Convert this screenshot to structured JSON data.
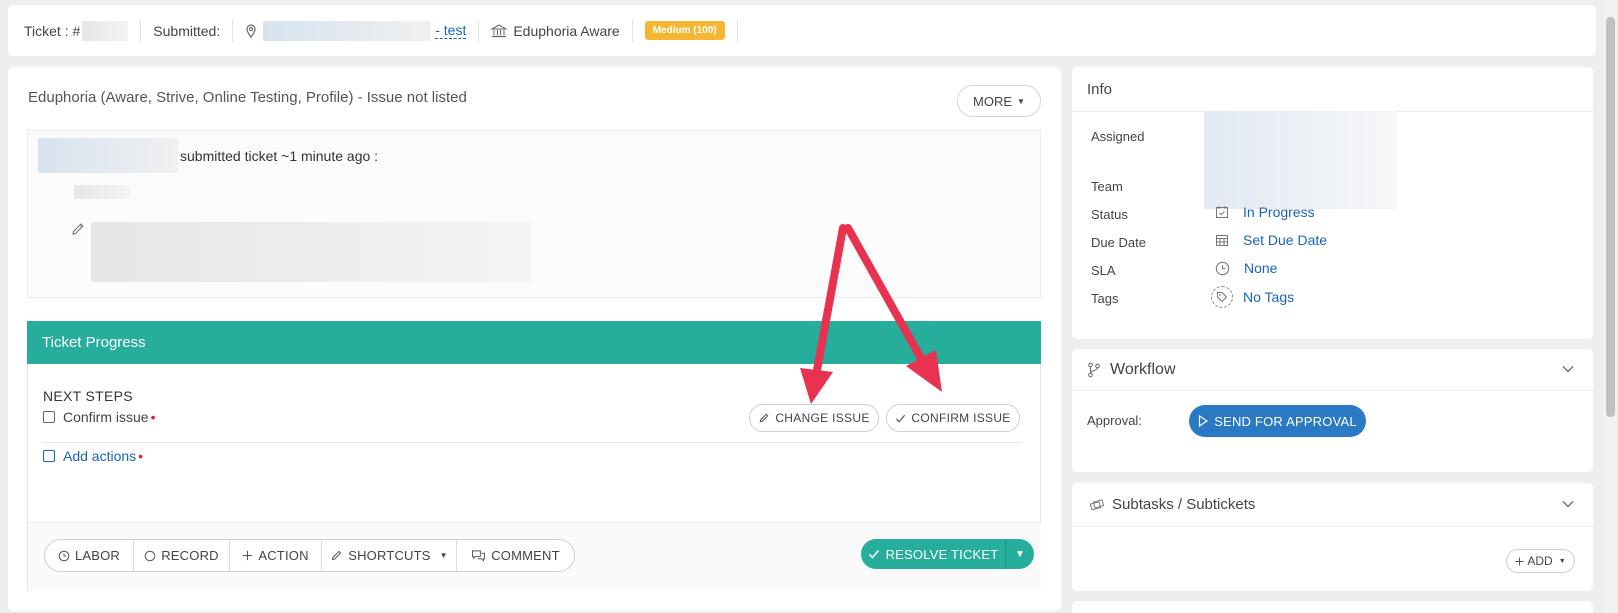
{
  "topbar": {
    "ticket_label": "Ticket : #",
    "submitted_label": "Submitted:",
    "location_suffix": "- test",
    "organization": "Eduphoria Aware",
    "priority_badge": "Medium (100)"
  },
  "ticket": {
    "title": "Eduphoria (Aware, Strive, Online Testing, Profile) - Issue not listed",
    "more_label": "MORE",
    "submitted_text": "submitted ticket ~1 minute ago :"
  },
  "progress": {
    "header": "Ticket Progress",
    "next_steps": "NEXT STEPS",
    "steps": [
      {
        "label": "Confirm issue",
        "required": "•"
      },
      {
        "label": "Add actions",
        "required": "•"
      }
    ],
    "change_issue": "CHANGE ISSUE",
    "confirm_issue": "CONFIRM ISSUE"
  },
  "footer": {
    "buttons": [
      "LABOR",
      "RECORD",
      "ACTION",
      "SHORTCUTS",
      "COMMENT"
    ],
    "resolve": "RESOLVE TICKET"
  },
  "info": {
    "header": "Info",
    "assigned": "Assigned",
    "team": "Team",
    "status_label": "Status",
    "status_value": "In Progress",
    "due_label": "Due Date",
    "due_value": "Set Due Date",
    "sla_label": "SLA",
    "sla_value": "None",
    "tags_label": "Tags",
    "tags_value": "No Tags"
  },
  "workflow": {
    "header": "Workflow",
    "approval_label": "Approval:",
    "send_button": "SEND FOR APPROVAL"
  },
  "subtasks": {
    "header": "Subtasks / Subtickets",
    "add_button": "ADD"
  },
  "colors": {
    "accent_teal": "#26ad9c",
    "link_blue": "#1a64b5",
    "badge_orange": "#f5b731",
    "annotation_red": "#e8324f"
  }
}
